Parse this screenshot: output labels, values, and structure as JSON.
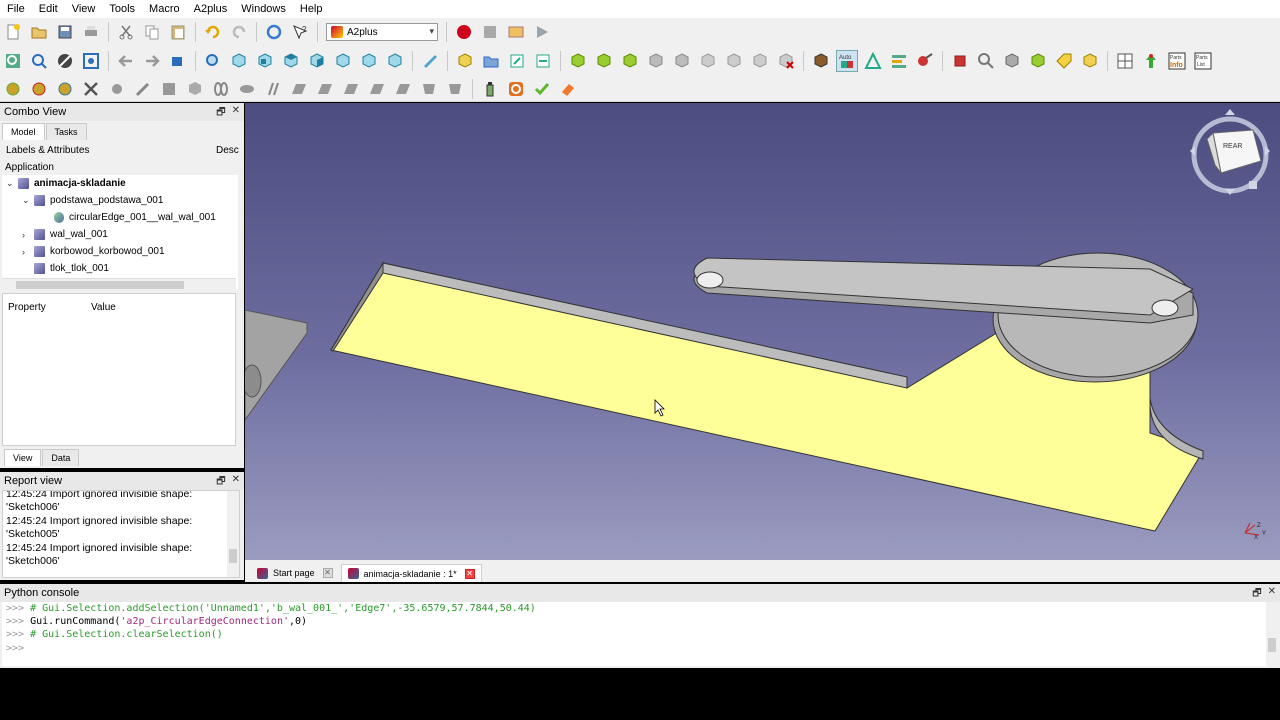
{
  "menu": [
    "File",
    "Edit",
    "View",
    "Tools",
    "Macro",
    "A2plus",
    "Windows",
    "Help"
  ],
  "workbench": {
    "selected": "A2plus"
  },
  "combo_view": {
    "title": "Combo View",
    "tabs": [
      "Model",
      "Tasks"
    ],
    "tree_header_left": "Labels & Attributes",
    "tree_header_right": "Desc",
    "application_label": "Application",
    "tree_items": [
      {
        "label": "animacja-skladanie",
        "bold": true
      },
      {
        "label": "podstawa_podstawa_001"
      },
      {
        "label": "circularEdge_001__wal_wal_001"
      },
      {
        "label": "wal_wal_001"
      },
      {
        "label": "korbowod_korbowod_001"
      },
      {
        "label": "tlok_tlok_001"
      }
    ],
    "property_header": "Property",
    "value_header": "Value",
    "bottom_tabs": [
      "View",
      "Data"
    ]
  },
  "report_view": {
    "title": "Report view",
    "lines": [
      "12:45:24  Import ignored invisible shape:",
      "'Sketch006'",
      "12:45:24  Import ignored invisible shape:",
      "'Sketch005'",
      "12:45:24  Import ignored invisible shape:",
      "'Sketch006'"
    ]
  },
  "doc_tabs": [
    {
      "label": "Start page",
      "active": false
    },
    {
      "label": "animacja-skladanie : 1*",
      "active": true
    }
  ],
  "python_console": {
    "title": "Python console",
    "prompt": ">>>",
    "line1": "# Gui.Selection.addSelection('Unnamed1','b_wal_001_','Edge7',-35.6579,57.7844,50.44)",
    "line2_a": "Gui.runCommand(",
    "line2_b": "'a2p_CircularEdgeConnection'",
    "line2_c": ",0)",
    "line3": "# Gui.Selection.clearSelection()"
  },
  "navcube": {
    "face_label": "REAR"
  },
  "colors": {
    "viewport_top": "#4c4c80",
    "viewport_bottom": "#9b9cc0",
    "plate": "#ffff99",
    "part_gray": "#a0a0a0"
  }
}
